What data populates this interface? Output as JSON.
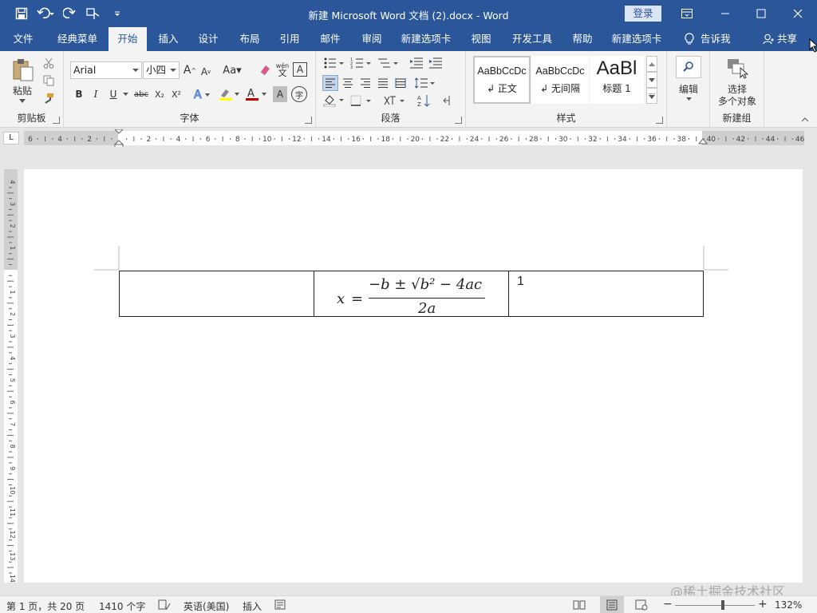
{
  "titlebar": {
    "title": "新建 Microsoft Word 文档 (2).docx  -  Word",
    "login_label": "登录"
  },
  "menu": {
    "tabs": [
      "文件",
      "经典菜单",
      "开始",
      "插入",
      "设计",
      "布局",
      "引用",
      "邮件",
      "审阅",
      "新建选项卡",
      "视图",
      "开发工具",
      "帮助",
      "新建选项卡"
    ],
    "active_tab": "开始",
    "tell_me": "告诉我",
    "share": "共享"
  },
  "ribbon": {
    "clipboard": {
      "paste_label": "粘贴",
      "group_label": "剪贴板"
    },
    "font": {
      "font_name": "Arial",
      "font_size": "小四",
      "group_label": "字体",
      "format_buttons": [
        "B",
        "I",
        "U",
        "abc",
        "X₂",
        "X²"
      ],
      "case_label": "Aa",
      "phonetic_label": "wén",
      "char_border_label": "A",
      "enclose_label": "字"
    },
    "paragraph": {
      "group_label": "段落"
    },
    "styles": {
      "group_label": "样式",
      "items": [
        {
          "preview": "AaBbCcDc",
          "name": "↲ 正文"
        },
        {
          "preview": "AaBbCcDc",
          "name": "↲ 无间隔"
        },
        {
          "preview": "AaBl",
          "name": "标题 1"
        }
      ]
    },
    "editing": {
      "label": "编辑"
    },
    "new_group": {
      "button_line1": "选择",
      "button_line2": "多个对象",
      "group_label": "新建组"
    }
  },
  "ruler": {
    "tab_selector": "L",
    "h_numbers": [
      "6",
      "4",
      "2",
      "",
      "2",
      "4",
      "6",
      "8",
      "10",
      "12",
      "14",
      "16",
      "18",
      "20",
      "22",
      "24",
      "26",
      "28",
      "30",
      "32",
      "34",
      "36",
      "38",
      "40",
      "42",
      "44",
      "46"
    ],
    "v_numbers": [
      "4",
      "3",
      "2",
      "1",
      "",
      "1",
      "2",
      "3",
      "4",
      "5",
      "6",
      "7",
      "8",
      "9",
      "10",
      "11",
      "12",
      "13",
      "14"
    ]
  },
  "document": {
    "table": {
      "cells": [
        "",
        "FORMULA",
        "1"
      ],
      "formula": {
        "lhs": "x",
        "equals": "=",
        "numerator": "−b ± √b² − 4ac",
        "denominator": "2a"
      }
    }
  },
  "statusbar": {
    "page": "第 1 页，共 20 页",
    "words": "1410 个字",
    "language": "英语(美国)",
    "insert_mode": "插入",
    "zoom": "132%",
    "zoom_fraction": 0.6
  },
  "watermark": "@稀土掘金技术社区",
  "colors": {
    "brand": "#2b579a",
    "ribbon_bg": "#f3f3f3",
    "workspace": "#e6e6e6"
  }
}
